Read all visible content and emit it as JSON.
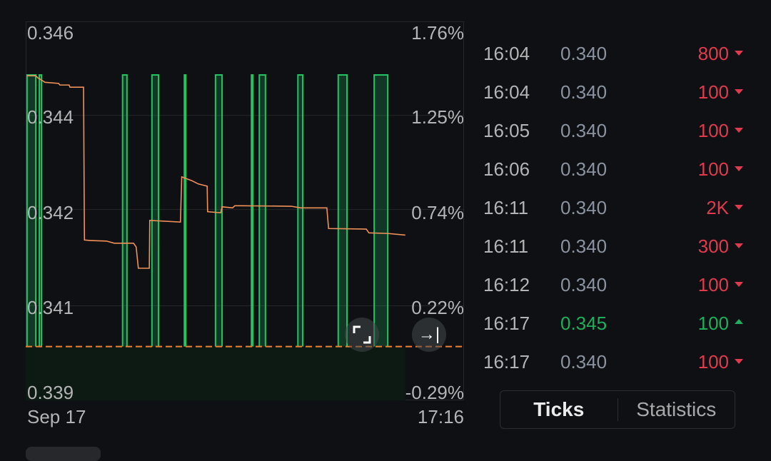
{
  "chart_data": {
    "type": "line",
    "title": "",
    "previous_close": 0.34,
    "ylim": [
      0.33901,
      0.34598
    ],
    "xlim": [
      0,
      100
    ],
    "grid": true,
    "left_tick_labels": [
      "0.346",
      "0.344",
      "0.342",
      "0.341",
      "0.339"
    ],
    "right_tick_labels": [
      "1.76%",
      "1.25%",
      "0.74%",
      "0.22%",
      "-0.29%"
    ],
    "tick_values": [
      0.34598,
      0.34425,
      0.34252,
      0.34075,
      0.33901
    ],
    "x_tick_labels": [
      "Sep 17",
      "17:16"
    ],
    "price_series": {
      "color": "#f0915a",
      "points": [
        [
          0.3,
          0.34498
        ],
        [
          2.3,
          0.34498
        ],
        [
          2.8,
          0.34494
        ],
        [
          4.4,
          0.34486
        ],
        [
          7.5,
          0.34484
        ],
        [
          7.8,
          0.34481
        ],
        [
          9.9,
          0.34481
        ],
        [
          10.1,
          0.34477
        ],
        [
          13.2,
          0.34477
        ],
        [
          13.4,
          0.34196
        ],
        [
          14.7,
          0.34195
        ],
        [
          18.4,
          0.34194
        ],
        [
          20.2,
          0.3419
        ],
        [
          24.6,
          0.3419
        ],
        [
          25.2,
          0.34183
        ],
        [
          25.7,
          0.34144
        ],
        [
          28.2,
          0.34144
        ],
        [
          28.3,
          0.34232
        ],
        [
          35.3,
          0.34229
        ],
        [
          35.6,
          0.34312
        ],
        [
          37.9,
          0.34305
        ],
        [
          39.4,
          0.34299
        ],
        [
          41.4,
          0.34295
        ],
        [
          41.5,
          0.34248
        ],
        [
          44.5,
          0.34246
        ],
        [
          44.8,
          0.34257
        ],
        [
          47.2,
          0.34255
        ],
        [
          47.7,
          0.34259
        ],
        [
          49.0,
          0.34259
        ],
        [
          60.6,
          0.34258
        ],
        [
          62.7,
          0.34255
        ],
        [
          68.7,
          0.34255
        ],
        [
          69.1,
          0.34217
        ],
        [
          77.7,
          0.34216
        ],
        [
          78.3,
          0.34209
        ],
        [
          82.6,
          0.34208
        ],
        [
          86.6,
          0.34205
        ]
      ]
    },
    "volume_series": {
      "color": "#22c363",
      "intervals": [
        [
          0.3,
          2.3
        ],
        [
          3.1,
          3.6
        ],
        [
          22.1,
          23.1
        ],
        [
          28.8,
          30.3
        ],
        [
          36.2,
          36.5
        ],
        [
          43.3,
          44.8
        ],
        [
          51.5,
          51.8
        ],
        [
          53.3,
          54.7
        ],
        [
          62.1,
          63.2
        ],
        [
          71.3,
          73.3
        ],
        [
          79.5,
          82.6
        ]
      ]
    },
    "reference_line_color": "#e8843a"
  },
  "controls": {
    "fullscreen_icon": "expand-corners-icon",
    "jump_latest_icon": "arrow-to-end-icon",
    "jump_latest_glyph": "→|"
  },
  "ticks": {
    "rows": [
      {
        "time": "16:04",
        "price": "0.340",
        "volume": "800",
        "dir": "down"
      },
      {
        "time": "16:04",
        "price": "0.340",
        "volume": "100",
        "dir": "down"
      },
      {
        "time": "16:05",
        "price": "0.340",
        "volume": "100",
        "dir": "down"
      },
      {
        "time": "16:06",
        "price": "0.340",
        "volume": "100",
        "dir": "down"
      },
      {
        "time": "16:11",
        "price": "0.340",
        "volume": "2K",
        "dir": "down"
      },
      {
        "time": "16:11",
        "price": "0.340",
        "volume": "300",
        "dir": "down"
      },
      {
        "time": "16:12",
        "price": "0.340",
        "volume": "100",
        "dir": "down"
      },
      {
        "time": "16:17",
        "price": "0.345",
        "volume": "100",
        "dir": "up"
      },
      {
        "time": "16:17",
        "price": "0.340",
        "volume": "100",
        "dir": "down"
      }
    ],
    "colors": {
      "up": "#1fae5c",
      "down": "#e03a4e"
    }
  },
  "tabs": {
    "ticks": "Ticks",
    "statistics": "Statistics"
  }
}
